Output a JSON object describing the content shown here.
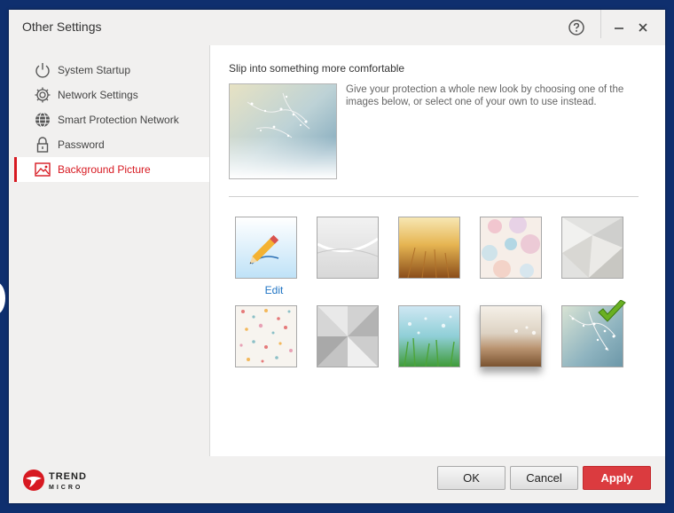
{
  "window": {
    "title": "Other Settings"
  },
  "titlebar": {
    "help_icon": "help-circle-icon",
    "minimize_icon": "minimize-icon",
    "close_icon": "close-icon"
  },
  "sidebar": {
    "items": [
      {
        "label": "System Startup",
        "icon": "power-icon"
      },
      {
        "label": "Network Settings",
        "icon": "gear-icon"
      },
      {
        "label": "Smart Protection Network",
        "icon": "globe-icon"
      },
      {
        "label": "Password",
        "icon": "lock-icon"
      },
      {
        "label": "Background Picture",
        "icon": "picture-icon",
        "active": true
      }
    ]
  },
  "main": {
    "heading": "Slip into something more comfortable",
    "description": "Give your protection a whole new look by choosing one of the images below, or select one of your own to use instead.",
    "edit_label": "Edit",
    "thumbnails": [
      {
        "name": "edit",
        "icon": "pencil-icon"
      },
      {
        "name": "white-waves"
      },
      {
        "name": "golden-wheat"
      },
      {
        "name": "pastel-circles"
      },
      {
        "name": "geometric-silver"
      },
      {
        "name": "confetti-dots"
      },
      {
        "name": "brushed-metal"
      },
      {
        "name": "green-grass"
      },
      {
        "name": "sandy-beach"
      },
      {
        "name": "blossom-branch",
        "selected": true
      }
    ]
  },
  "footer": {
    "logo_text": "TREND",
    "logo_subtext": "MICRO",
    "ok_label": "OK",
    "cancel_label": "Cancel",
    "apply_label": "Apply"
  },
  "colors": {
    "accent": "#d71921",
    "apply": "#db3b3f",
    "link": "#1f74c4",
    "desktop": "#0f2f6e"
  }
}
